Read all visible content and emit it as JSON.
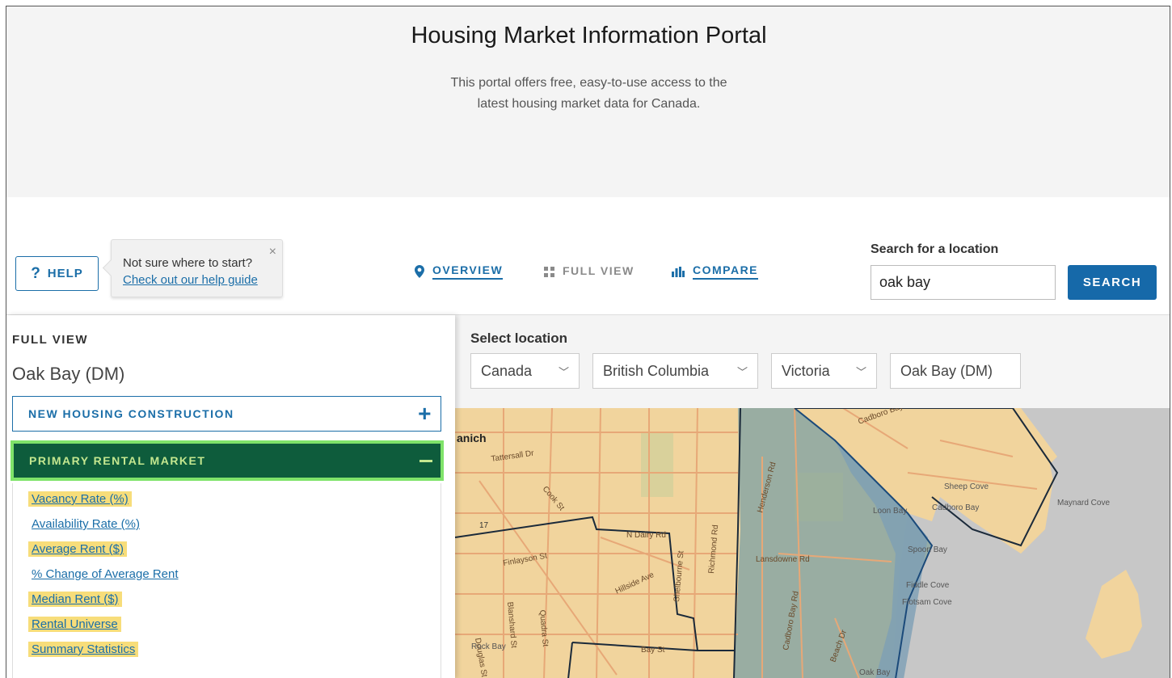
{
  "hero": {
    "title": "Housing Market Information Portal",
    "subtitle_line1": "This portal offers free, easy-to-use access to the",
    "subtitle_line2": "latest housing market data for Canada."
  },
  "toolbar": {
    "help_label": "HELP",
    "help_icon": "?",
    "tip_text": "Not sure where to start?",
    "tip_link": "Check out our help guide",
    "tip_close": "×",
    "nav": [
      {
        "label": "OVERVIEW",
        "icon": "map-pin-icon",
        "active": true
      },
      {
        "label": "FULL VIEW",
        "icon": "grid-icon",
        "active": false
      },
      {
        "label": "COMPARE",
        "icon": "bar-chart-icon",
        "active": true
      }
    ],
    "search_label": "Search for a location",
    "search_value": "oak bay",
    "search_button": "SEARCH"
  },
  "panel": {
    "section_title": "FULL VIEW",
    "location": "Oak Bay (DM)",
    "accordions": [
      {
        "label": "NEW HOUSING CONSTRUCTION",
        "sign": "+"
      },
      {
        "label": "PRIMARY RENTAL MARKET",
        "sign": "–"
      }
    ],
    "links": [
      {
        "label": "Vacancy Rate (%)",
        "highlighted": true
      },
      {
        "label": "Availability Rate (%)",
        "highlighted": false
      },
      {
        "label": "Average Rent ($)",
        "highlighted": true
      },
      {
        "label": "% Change of Average Rent",
        "highlighted": false
      },
      {
        "label": "Median Rent ($)",
        "highlighted": true
      },
      {
        "label": "Rental Universe",
        "highlighted": true
      },
      {
        "label": "Summary Statistics",
        "highlighted": true
      }
    ]
  },
  "location_select": {
    "label": "Select location",
    "country": "Canada",
    "province": "British Columbia",
    "cma": "Victoria",
    "municipality": "Oak Bay (DM)"
  },
  "map": {
    "labels": {
      "saanich": "anich",
      "tattersall": "Tattersall Dr",
      "cook": "Cook St",
      "cadboro_bay_rd_n": "Cadboro Bay Rd",
      "henderson": "Henderson Rd",
      "sheep_cove": "Sheep Cove",
      "cadboro_bay": "Cadboro Bay",
      "maynard_cove": "Maynard Cove",
      "loon_bay": "Loon Bay",
      "spoon_bay": "Spoon Bay",
      "fiddle_cove": "Fiddle Cove",
      "flotsam_cove": "Flotsam Cove",
      "n_dairy": "N Dairy Rd",
      "finlayson": "Finlayson St",
      "hillside": "Hillside Ave",
      "shelbourne": "Shelbourne St",
      "richmond": "Richmond Rd",
      "lansdowne": "Lansdowne Rd",
      "cadboro_bay_rd": "Cadboro Bay Rd",
      "beach": "Beach Dr",
      "douglas": "Douglas St",
      "blanshard": "Blanshard St",
      "quadra": "Quadra St",
      "rock_bay": "Rock Bay",
      "bay_st": "Bay St",
      "oak_bay": "Oak Bay",
      "hwy": "17"
    },
    "colors": {
      "land": "#f1d49d",
      "water": "#c7c7c7",
      "oak_bay_fill": "#8fa8a3",
      "roads": "#e7a877",
      "boundary": "#1b2a3a"
    }
  },
  "colors": {
    "brand_blue": "#1669a9",
    "rental_green": "#0e5c3c",
    "highlight_yellow": "#f7dd7a"
  }
}
